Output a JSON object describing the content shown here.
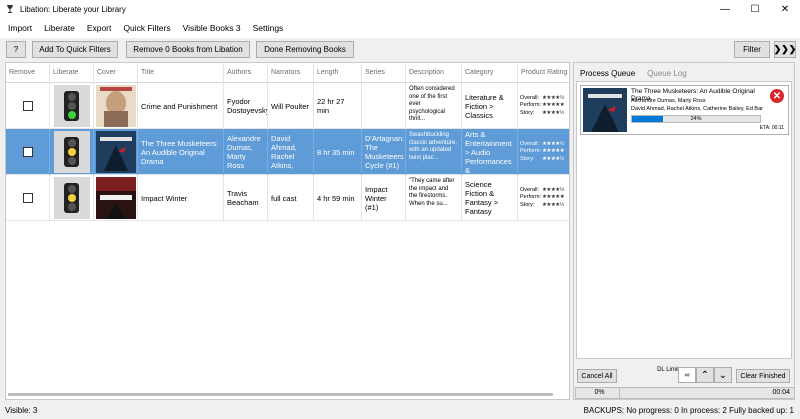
{
  "window": {
    "title": "Libation: Liberate your Library",
    "minimize_glyph": "—",
    "maximize_glyph": "☐",
    "close_glyph": "✕"
  },
  "menu": [
    "Import",
    "Liberate",
    "Export",
    "Quick Filters",
    "Visible Books 3",
    "Settings"
  ],
  "toolbar": {
    "help_label": "?",
    "add_quick_filters_label": "Add To Quick Filters",
    "remove_books_label": "Remove 0 Books from Libation",
    "done_removing_label": "Done Removing Books",
    "filter_label": "Filter",
    "expand_glyph": "❯❯❯"
  },
  "grid": {
    "headers": [
      "Remove",
      "Liberate",
      "Cover",
      "Title",
      "Authors",
      "Narrators",
      "Length",
      "Series",
      "Description",
      "Category",
      "Product Rating"
    ],
    "rating_labels": [
      "Overall:",
      "Perform:",
      "Story:"
    ],
    "rows": [
      {
        "title": "Crime and Punishment",
        "authors": "Fyodor Dostoyevsky",
        "narrators": "Will Poulter",
        "length": "22 hr 27 min",
        "series": "",
        "description": "Often considered one of the first ever psychological thrill...",
        "category": "Literature & Fiction > Classics",
        "rating": [
          "★★★★½",
          "★★★★★",
          "★★★★½"
        ],
        "status": "liberated",
        "selected": false
      },
      {
        "title": "The Three Musketeers: An Audible Original Drama",
        "authors": "Alexandre Dumas, Marty Ross",
        "narrators": "David Ahmad, Rachel Atkins,",
        "length": "8 hr 35 min",
        "series": "D'Artagnan: The Musketeers Cycle (#1)",
        "description": "Swashbuckling classic adventure, with an updated twist plac...",
        "category": "Arts & Entertainment > Audio Performances &",
        "rating": [
          "★★★★½",
          "★★★★★",
          "★★★★½"
        ],
        "status": "downloading",
        "selected": true
      },
      {
        "title": "Impact Winter",
        "authors": "Travis Beacham",
        "narrators": "full cast",
        "length": "4 hr 59 min",
        "series": "Impact Winter (#1)",
        "description": "\"They came after the impact and the firestorms. When the su...",
        "category": "Science Fiction & Fantasy > Fantasy",
        "rating": [
          "★★★★½",
          "★★★★★",
          "★★★★½"
        ],
        "status": "queued",
        "selected": false
      }
    ]
  },
  "side": {
    "tabs": [
      "Process Queue",
      "Queue Log"
    ],
    "queue_item": {
      "title": "The Three Musketeers: An Audible Original Drama",
      "authors": "Alexandre Dumas, Marty Ross",
      "narrators": "David Ahmad, Rachel Atkins, Catherine Bailey, Ed Bar",
      "progress_text": "24%",
      "progress": 0.24,
      "eta": "ETA: 00:11",
      "cancel_glyph": "✕"
    },
    "cancel_all_label": "Cancel All",
    "dl_limit_label": "DL Limit",
    "dl_limit_value": "∞",
    "up_glyph": "⌃",
    "down_glyph": "⌄",
    "clear_finished_label": "Clear Finished",
    "overall_progress": "0%",
    "elapsed": "00:04"
  },
  "status": {
    "visible": "Visible: 3",
    "backups": "BACKUPS: No progress: 0  In process: 2  Fully backed up: 1"
  },
  "colors": {
    "selected_row": "#5e9bd7",
    "progress_fill": "#0078d7",
    "cancel_red": "#d9262b"
  }
}
